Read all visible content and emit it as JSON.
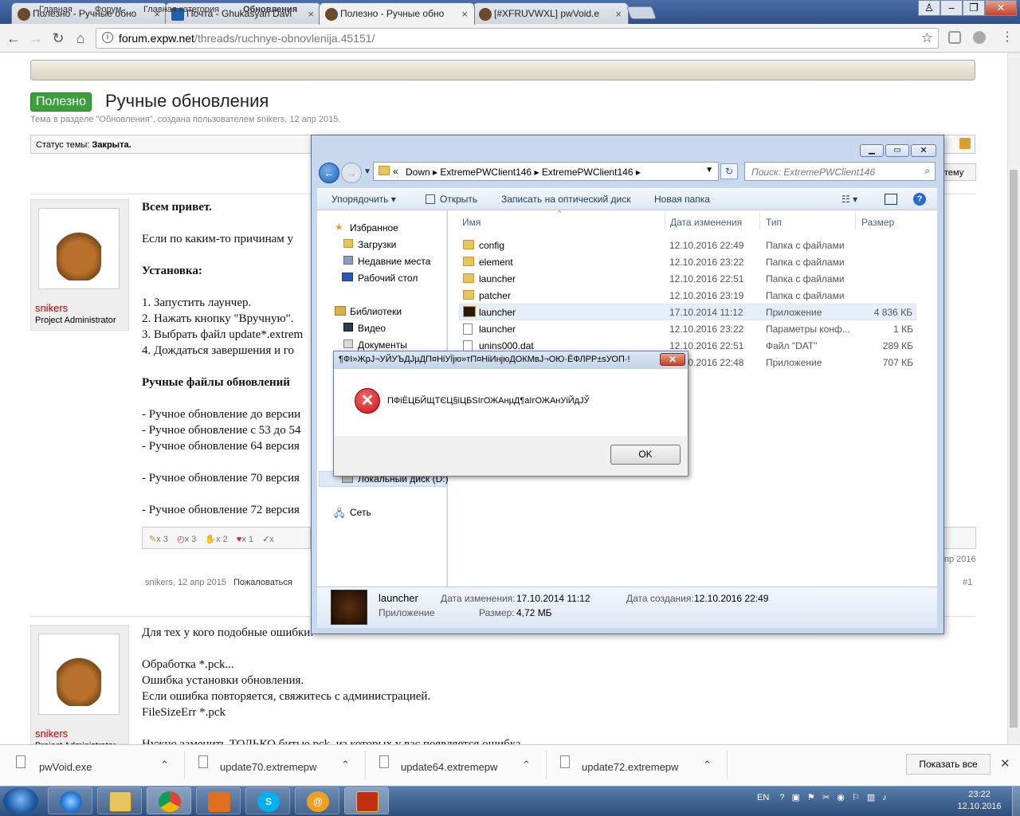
{
  "browser": {
    "tabs": [
      {
        "label": "Полезно - Ручные обно"
      },
      {
        "label": "Почта - Ghukasyan Davi"
      },
      {
        "label": "Полезно - Ручные обно"
      },
      {
        "label": "[#XFRUVWXL] pwVoid.e"
      }
    ],
    "url_host": "forum.expw.net",
    "url_path": "/threads/ruchnye-obnovlenija.45151/"
  },
  "forum": {
    "breadcrumb": [
      "Главная",
      "Форум",
      "Главная категория",
      "Обновления"
    ],
    "prefix": "Полезно",
    "title": "Ручные обновления",
    "subtitle": "Тема в разделе \"Обновления\", создана пользователем snikers, 12 апр 2015.",
    "status_label": "Статус темы:",
    "status_value": "Закрыта.",
    "reply_button": "тему",
    "posts": [
      {
        "author": "snikers",
        "author_title": "Project Administrator",
        "lines": [
          "Всем привет.",
          "Если по каким-то причинам у",
          "Установка:",
          "1. Запустить лаунчер.",
          "2. Нажать кнопку \"Вручную\".",
          "3. Выбрать файл update*.extrem",
          "4. Дождаться завершения и го",
          "Ручные файлы обновлений",
          "- Ручное обновление до версии",
          "- Ручное обновление с 53 до 54",
          "- Ручное обновление 64 версия",
          "- Ручное обновление 70 версия",
          "- Ручное обновление 72 версия"
        ],
        "likes": [
          "x 3",
          "x 3",
          "x 2",
          "x 1",
          "x"
        ],
        "meta_author_date": "snikers, 12 апр 2015",
        "report": "Пожаловаться",
        "edited_tail": "пр 2016",
        "post_number": "#1"
      },
      {
        "author": "snikers",
        "author_title": "Project Administrator",
        "lines": [
          "Для тех у кого подобные ошибки:",
          "Обработка *.pck...",
          "Ошибка установки обновления.",
          "Если ошибка повторяется, свяжитесь с администрацией.",
          "FileSizeErr *.pck",
          "Нужно заменить ТОЛЬКО битые pck, из которых у вас появляется ошибка."
        ]
      }
    ]
  },
  "explorer": {
    "path": [
      "Down",
      "ExtremePWClient146",
      "ExtremePWClient146"
    ],
    "search_placeholder": "Поиск: ExtremePWClient146",
    "commands": [
      "Упорядочить ▾",
      "Открыть",
      "Записать на оптический диск",
      "Новая папка"
    ],
    "nav": {
      "favorites": "Избранное",
      "downloads": "Загрузки",
      "recent": "Недавние места",
      "desktop": "Рабочий стол",
      "libraries": "Библиотеки",
      "video": "Видео",
      "documents": "Документы",
      "local_disk": "Локальный диск (D:)",
      "network": "Сеть"
    },
    "columns": [
      "Имя",
      "Дата изменения",
      "Тип",
      "Размер"
    ],
    "files": [
      {
        "name": "config",
        "date": "12.10.2016 22:49",
        "type": "Папка с файлами",
        "size": ""
      },
      {
        "name": "element",
        "date": "12.10.2016 23:22",
        "type": "Папка с файлами",
        "size": ""
      },
      {
        "name": "launcher",
        "date": "12.10.2016 22:51",
        "type": "Папка с файлами",
        "size": ""
      },
      {
        "name": "patcher",
        "date": "12.10.2016 23:19",
        "type": "Папка с файлами",
        "size": ""
      },
      {
        "name": "launcher",
        "date": "17.10.2014 11:12",
        "type": "Приложение",
        "size": "4 836 КБ"
      },
      {
        "name": "launcher",
        "date": "12.10.2016 23:22",
        "type": "Параметры конф...",
        "size": "1 КБ"
      },
      {
        "name": "unins000.dat",
        "date": "12.10.2016 22:51",
        "type": "Файл \"DAT\"",
        "size": "289 КБ"
      },
      {
        "name": "",
        "date": "12.10.2016 22:48",
        "type": "Приложение",
        "size": "707 КБ"
      }
    ],
    "details": {
      "name": "launcher",
      "kind": "Приложение",
      "modified_label": "Дата изменения:",
      "modified": "17.10.2014 11:12",
      "size_label": "Размер:",
      "size": "4,72 МБ",
      "created_label": "Дата создания:",
      "created": "12.10.2016 22:49"
    }
  },
  "dialog": {
    "title": "¶ФІ»ЖрЈ¬УЙУЪДЈµДП¤НіУЇјю»тП¤НіИнјюДОКМвЈ¬ОЮ·ЁФЛРР±sУОП·!",
    "message": "ПФіЁЦБЙЩТЄЦ§іЦБЅIгОЖАнµД¶аIгОЖАнУіЙдЈЎ",
    "ok": "OK"
  },
  "downloads": {
    "items": [
      "pwVoid.exe",
      "update70.extremepw",
      "update64.extremepw",
      "update72.extremepw"
    ],
    "show_all": "Показать все"
  },
  "taskbar": {
    "lang": "EN",
    "time": "23:22",
    "date": "12.10.2016"
  }
}
